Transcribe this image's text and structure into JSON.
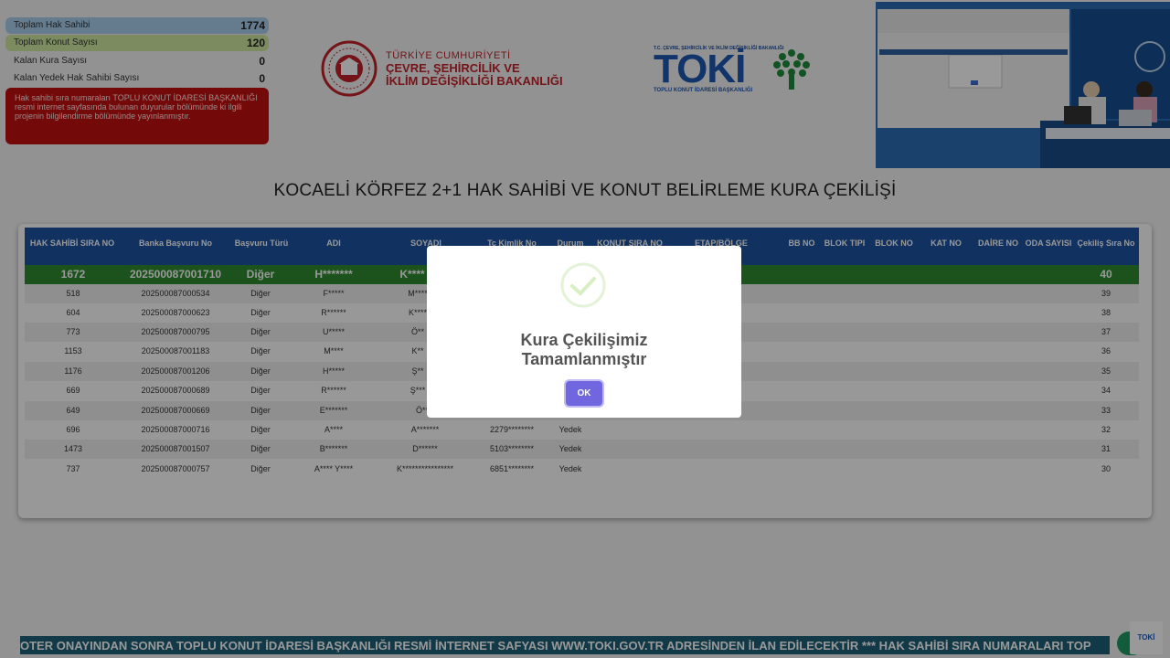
{
  "stats": [
    {
      "label": "Toplam Hak Sahibi",
      "value": "1774"
    },
    {
      "label": "Toplam Konut Sayısı",
      "value": "120"
    },
    {
      "label": "Kalan Kura Sayısı",
      "value": "0"
    },
    {
      "label": "Kalan Yedek Hak Sahibi Sayısı",
      "value": "0"
    }
  ],
  "notice": "Hak sahibi sıra numaraları TOPLU KONUT İDARESİ BAŞKANLIĞI resmi internet sayfasında bulunan duyurular bölümünde ki ilgili projenin bilgilendirme bölümünde yayınlanmıştır.",
  "ministry": {
    "line1": "TÜRKİYE CUMHURİYETİ",
    "line2": "ÇEVRE, ŞEHİRCİLİK VE",
    "line3": "İKLİM DEĞİŞİKLİĞİ BAKANLIĞI"
  },
  "toki": {
    "top": "T.C. ÇEVRE, ŞEHİRCİLİK VE İKLİM DEĞİŞİKLİĞİ BAKANLIĞI",
    "name": "TOKİ",
    "sub": "TOPLU KONUT İDARESİ BAŞKANLIĞI"
  },
  "title": "KOCAELİ KÖRFEZ 2+1 HAK SAHİBİ VE KONUT BELİRLEME KURA ÇEKİLİŞİ",
  "table": {
    "headers": [
      "HAK SAHİBİ SIRA NO",
      "Banka Başvuru No",
      "Başvuru Türü",
      "ADI",
      "SOYADI",
      "Tc Kimlik No",
      "Durum",
      "KONUT SIRA NO",
      "ETAP/BÖLGE",
      "BB NO",
      "BLOK TIPI",
      "BLOK NO",
      "KAT NO",
      "DAİRE NO",
      "ODA SAYISI",
      "Çekiliş Sıra No"
    ],
    "highlight": [
      "1672",
      "202500087001710",
      "Diğer",
      "H*******",
      "K****",
      "40"
    ],
    "rows": [
      [
        "518",
        "202500087000534",
        "Diğer",
        "F*****",
        "M****",
        "",
        "",
        "39"
      ],
      [
        "604",
        "202500087000623",
        "Diğer",
        "R******",
        "K****",
        "",
        "",
        "38"
      ],
      [
        "773",
        "202500087000795",
        "Diğer",
        "U*****",
        "Ö**",
        "",
        "",
        "37"
      ],
      [
        "1153",
        "202500087001183",
        "Diğer",
        "M****",
        "K**",
        "",
        "",
        "36"
      ],
      [
        "1176",
        "202500087001206",
        "Diğer",
        "H*****",
        "Ş**",
        "",
        "",
        "35"
      ],
      [
        "669",
        "202500087000689",
        "Diğer",
        "R******",
        "Ş***",
        "",
        "",
        "34"
      ],
      [
        "649",
        "202500087000669",
        "Diğer",
        "E*******",
        "Ö**********",
        "",
        "",
        "33"
      ],
      [
        "696",
        "202500087000716",
        "Diğer",
        "A****",
        "A*******",
        "2279********",
        "Yedek",
        "32"
      ],
      [
        "1473",
        "202500087001507",
        "Diğer",
        "B*******",
        "D******",
        "5103********",
        "Yedek",
        "31"
      ],
      [
        "737",
        "202500087000757",
        "Diğer",
        "A**** Y****",
        "K****************",
        "6851********",
        "Yedek",
        "30"
      ]
    ]
  },
  "ticker": "OTER ONAYINDAN SONRA TOPLU KONUT İDARESİ BAŞKANLIĞI RESMİ İNTERNET SAFYASI WWW.TOKI.GOV.TR ADRESİNDEN İLAN EDİLECEKTİR *** HAK SAHİBİ SIRA NUMARALARI TOP",
  "corner_logo": "TOKİ",
  "modal": {
    "title_line1": "Kura Çekilişimiz",
    "title_line2": "Tamamlanmıştır",
    "ok_label": "OK"
  },
  "colors": {
    "header_blue": "#1d52a0",
    "highlight_green": "#2f8a2f",
    "notice_red": "#c21010",
    "ok_purple": "#7066e0",
    "ticker_teal": "#1e5f77"
  }
}
